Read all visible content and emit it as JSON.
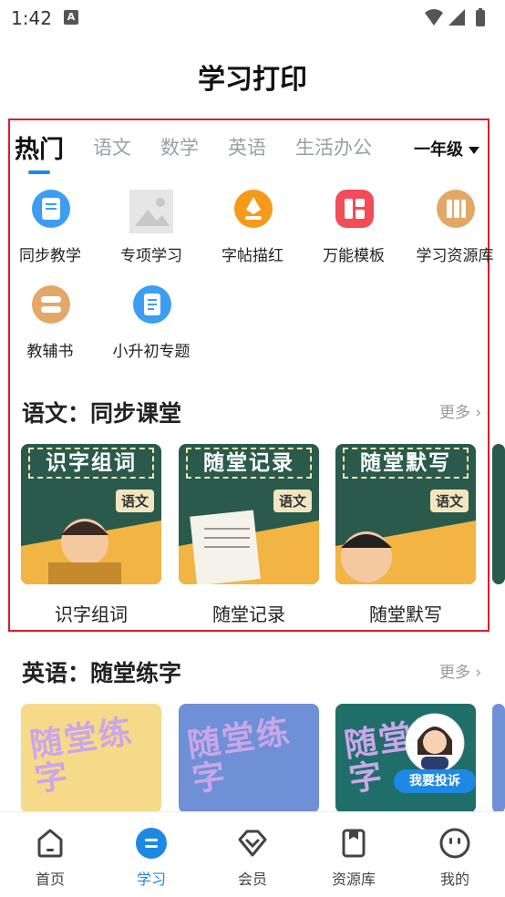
{
  "status_bar": {
    "time": "1:42",
    "notif_letter": "A"
  },
  "page": {
    "title": "学习打印"
  },
  "tabs": [
    "热门",
    "语文",
    "数学",
    "英语",
    "生活办公"
  ],
  "grade_selector": {
    "label": "一年级"
  },
  "grid": [
    {
      "label": "同步教学",
      "icon": "book-blue-icon",
      "color": "#3d9df0"
    },
    {
      "label": "专项学习",
      "icon": "image-placeholder-icon",
      "color": "#d9d9d9"
    },
    {
      "label": "字帖描红",
      "icon": "pen-orange-icon",
      "color": "#f59a1b"
    },
    {
      "label": "万能模板",
      "icon": "template-red-icon",
      "color": "#f24c58"
    },
    {
      "label": "学习资源库",
      "icon": "bookshelf-icon",
      "color": "#e3a867"
    },
    {
      "label": "教辅书",
      "icon": "books-stack-icon",
      "color": "#e3a867"
    },
    {
      "label": "小升初专题",
      "icon": "document-blue-icon",
      "color": "#3d9df0"
    }
  ],
  "section_chinese": {
    "title": "语文：同步课堂",
    "more": "更多",
    "cards": [
      {
        "sign": "识字组词",
        "badge": "语文",
        "caption": "识字组词"
      },
      {
        "sign": "随堂记录",
        "badge": "语文",
        "caption": "随堂记录"
      },
      {
        "sign": "随堂默写",
        "badge": "语文",
        "caption": "随堂默写"
      }
    ]
  },
  "section_english": {
    "title": "英语：随堂练字",
    "more": "更多",
    "cards": [
      {
        "text": "随堂练字",
        "bg": "#f7d98a"
      },
      {
        "text": "随堂练字",
        "bg": "#6f8fd6"
      },
      {
        "text": "随堂练字",
        "bg": "#1f6e6a"
      }
    ]
  },
  "complaint_button": {
    "label": "我要投诉"
  },
  "bottom_nav": [
    {
      "label": "首页",
      "icon": "home-icon"
    },
    {
      "label": "学习",
      "icon": "study-icon",
      "active": true
    },
    {
      "label": "会员",
      "icon": "diamond-icon"
    },
    {
      "label": "资源库",
      "icon": "library-icon"
    },
    {
      "label": "我的",
      "icon": "profile-icon"
    }
  ]
}
